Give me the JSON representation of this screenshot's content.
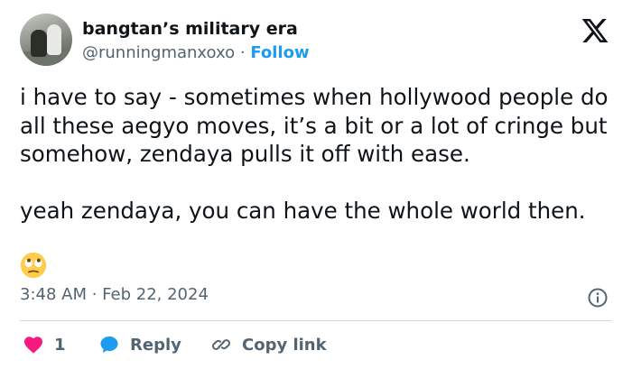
{
  "author": {
    "display_name": "bangtan’s military era",
    "handle": "@runningmanxoxo",
    "separator": "·",
    "follow_label": "Follow"
  },
  "post": {
    "text": "i have to say - sometimes when hollywood people do all these aegyo moves, it’s a bit or a lot of cringe but somehow, zendaya pulls it off with ease.\n\nyeah zendaya, you can have the whole world then.",
    "emoji": "face-with-rolling-eyes",
    "timestamp": "3:48 AM · Feb 22, 2024"
  },
  "actions": {
    "like_count": "1",
    "reply_label": "Reply",
    "copy_link_label": "Copy link"
  },
  "colors": {
    "accent": "#1d9bf0",
    "like": "#f91880",
    "muted_text": "#536471",
    "divider": "#cfd9de"
  },
  "icons": [
    "x-logo-icon",
    "info-icon",
    "heart-icon",
    "reply-bubble-icon",
    "link-icon"
  ]
}
